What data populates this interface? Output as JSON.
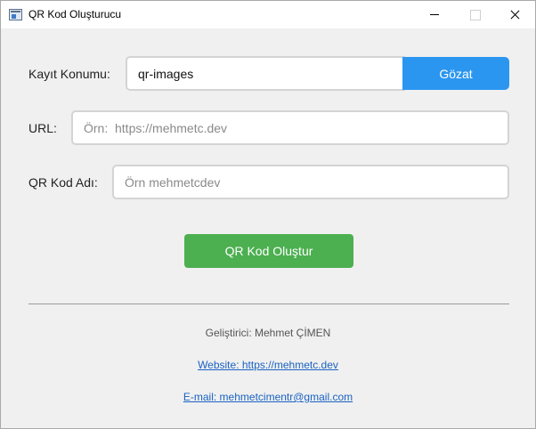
{
  "window": {
    "title": "QR Kod Oluşturucu"
  },
  "form": {
    "save_location_label": "Kayıt Konumu:",
    "save_location_value": "qr-images",
    "browse_label": "Gözat",
    "url_label": "URL:",
    "url_placeholder": "Örn:  https://mehmetc.dev",
    "name_label": "QR Kod Adı:",
    "name_placeholder": "Örn mehmetcdev",
    "generate_label": "QR Kod Oluştur"
  },
  "footer": {
    "developer": "Geliştirici: Mehmet ÇİMEN",
    "website": "Website: https://mehmetc.dev",
    "email": "E-mail: mehmetcimentr@gmail.com"
  },
  "colors": {
    "browse_button": "#2b96f0",
    "generate_button": "#4caf50",
    "link": "#1a62c2"
  }
}
